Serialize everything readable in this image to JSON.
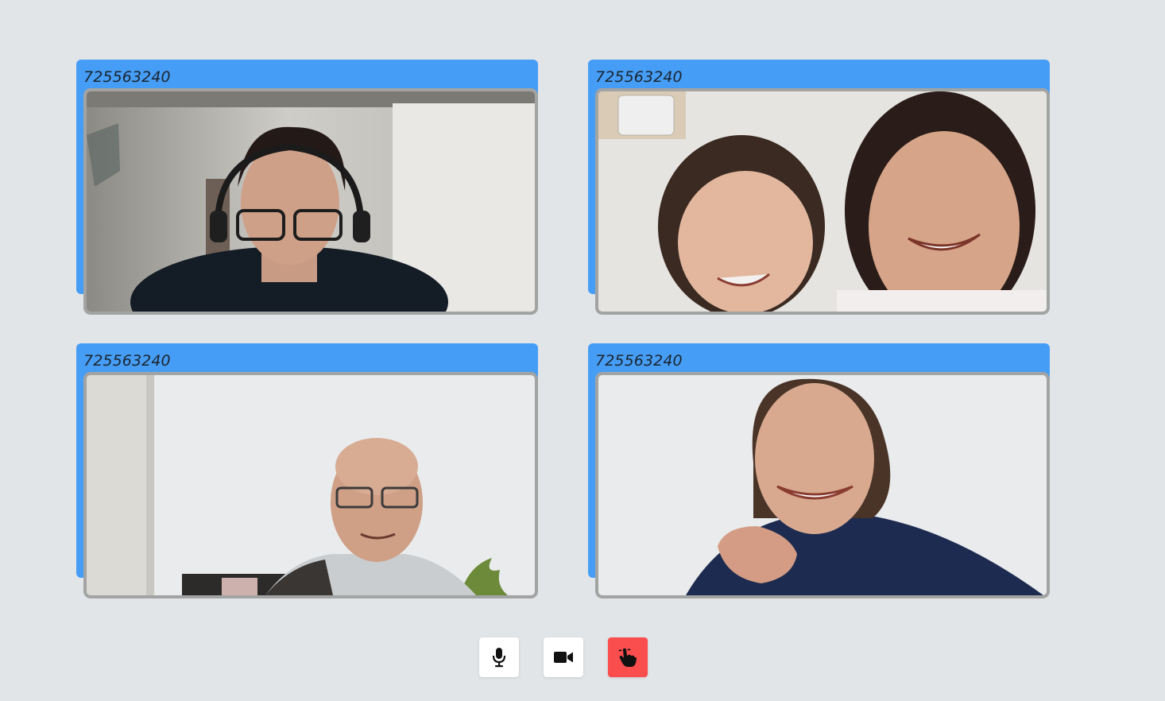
{
  "participants": [
    {
      "id_label": "725563240"
    },
    {
      "id_label": "725563240"
    },
    {
      "id_label": "725563240"
    },
    {
      "id_label": "725563240"
    }
  ],
  "controls": {
    "microphone": {
      "icon": "microphone-icon"
    },
    "camera": {
      "icon": "video-camera-icon"
    },
    "raise_hand": {
      "icon": "raised-hand-icon",
      "background": "#fa4d4d"
    }
  },
  "colors": {
    "page_background": "#e2e5e8",
    "tile_accent": "#469df5",
    "video_border": "#a2a3a3",
    "label_text": "#1b2530"
  }
}
